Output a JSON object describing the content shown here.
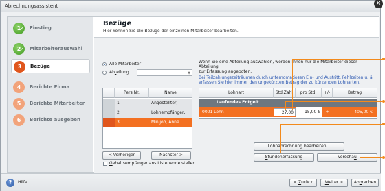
{
  "window": {
    "title": "Abrechnungsassistent"
  },
  "sidebar": {
    "steps": [
      {
        "num": "1",
        "label": "Einstieg",
        "state": "done"
      },
      {
        "num": "2",
        "label": "Mitarbeiterauswahl",
        "state": "done"
      },
      {
        "num": "3",
        "label": "Bezüge",
        "state": "active"
      },
      {
        "num": "4",
        "label": "Berichte Firma",
        "state": "todo"
      },
      {
        "num": "5",
        "label": "Berichte Mitarbeiter",
        "state": "todo"
      },
      {
        "num": "6",
        "label": "Berichte ausgeben",
        "state": "todo"
      }
    ]
  },
  "header": {
    "title": "Bezüge",
    "subtitle": "Hier können Sie die Bezüge der einzelnen Mitarbeiter bearbeiten."
  },
  "filter": {
    "all_label_u": "A",
    "all_label_rest": "lle Mitarbeiter",
    "dept_label_pre": "Ab",
    "dept_label_u": "t",
    "dept_label_rest": "eilung"
  },
  "info": {
    "line1": "Wenn Sie eine Abteilung auswählen, werden Ihnen nur die Mitarbeiter dieser Abteilung",
    "line2": "zur  Erfassung angeboten.",
    "line3": "Bei Teilzahlungszeiträumen durch unternomatiosen Ein- und Austritt, Fehlzeiten u. ä.",
    "line4": "erfassen Sie hier immer den ungekürzten Betrag der zu kürzenden Lohnarten."
  },
  "employees": {
    "headers": [
      "Pers.Nr.",
      "Name"
    ],
    "rows": [
      {
        "nr": "1",
        "name": "Angestellter, Karsten"
      },
      {
        "nr": "2",
        "name": "Lohnempfänger, Hans"
      },
      {
        "nr": "3",
        "name": "Minijob, Anne"
      }
    ]
  },
  "wages": {
    "headers": [
      "Lohnart",
      "Std.Zahl",
      "pro Std.",
      "+/-",
      "Betrag"
    ],
    "group": "Laufendes Entgelt",
    "rows": [
      {
        "lohnart": "0001 Lohn",
        "std": "27,00",
        "pro": "15,00 €",
        "sign": "+",
        "betrag": "405,00 €"
      }
    ]
  },
  "nav": {
    "prev_pre": "< ",
    "prev_u": "V",
    "prev_rest": "orheriger",
    "next_u": "N",
    "next_rest": "ächster >"
  },
  "checkbox": {
    "u": "G",
    "rest": "ehaltsempfänger ans Listenende stellen"
  },
  "actions": {
    "lohn_edit": "Lohnabrechnung bearbeiten...",
    "stunden_u": "S",
    "stunden_rest": "tundenerfassung",
    "vorschau_pre": "Vorscha",
    "vorschau_u": "u"
  },
  "footer": {
    "help": "Hilfe",
    "back_pre": "< ",
    "back_u": "Z",
    "back_rest": "urück",
    "next_u": "W",
    "next_rest": "eiter >",
    "cancel_pre": "Ab",
    "cancel_u": "b",
    "cancel_rest": "rechen"
  },
  "colors": {
    "accent_orange": "#e0561d",
    "selected_row": "#f37021",
    "group_row": "#6e7780",
    "callout": "#f28a1c"
  }
}
